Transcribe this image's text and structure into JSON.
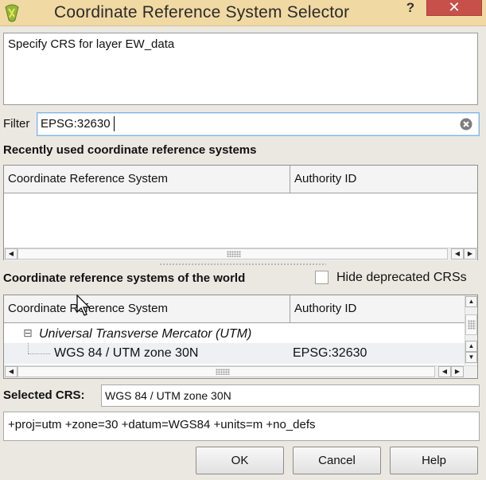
{
  "window": {
    "title": "Coordinate Reference System Selector",
    "help_glyph": "?",
    "close_glyph": "✕"
  },
  "description": "Specify CRS for layer EW_data",
  "filter": {
    "label": "Filter",
    "value": "EPSG:32630"
  },
  "recent": {
    "heading": "Recently used coordinate reference systems",
    "columns": [
      "Coordinate Reference System",
      "Authority ID"
    ]
  },
  "world": {
    "heading": "Coordinate reference systems of the world",
    "hide_deprecated_label": "Hide deprecated CRSs",
    "hide_deprecated_checked": false,
    "columns": [
      "Coordinate Reference System",
      "Authority ID"
    ],
    "group": {
      "expander": "⊟",
      "name": "Universal Transverse Mercator (UTM)"
    },
    "rows": [
      {
        "name": "WGS 84 / UTM zone 30N",
        "authority_id": "EPSG:32630"
      }
    ]
  },
  "selected": {
    "label": "Selected CRS:",
    "value": "WGS 84 / UTM zone 30N",
    "proj4": "+proj=utm +zone=30 +datum=WGS84 +units=m +no_defs"
  },
  "buttons": {
    "ok": "OK",
    "cancel": "Cancel",
    "help": "Help"
  },
  "scroll_glyphs": {
    "left": "◀",
    "right": "▶",
    "up": "▲",
    "down": "▼"
  },
  "colors": {
    "titlebar": "#f1d9a3",
    "close_button": "#c7504a",
    "focus_border": "#7eb4ea"
  }
}
